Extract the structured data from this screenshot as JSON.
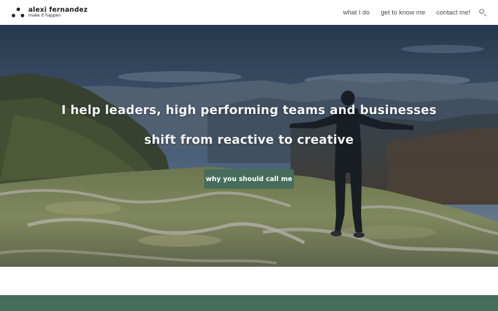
{
  "brand": {
    "name": "alexi fernandez",
    "tagline": "make it happen"
  },
  "nav": {
    "items": [
      "what I do",
      "get to know me",
      "contact me!"
    ],
    "search_icon": "search-icon"
  },
  "hero": {
    "line1": "I help leaders, high performing teams and businesses",
    "line2": "shift from reactive to creative",
    "cta_label": "why you should call me"
  },
  "colors": {
    "accent": "#466d5b",
    "header_bg": "#ffffff",
    "hero_text": "#f4f4f4"
  }
}
